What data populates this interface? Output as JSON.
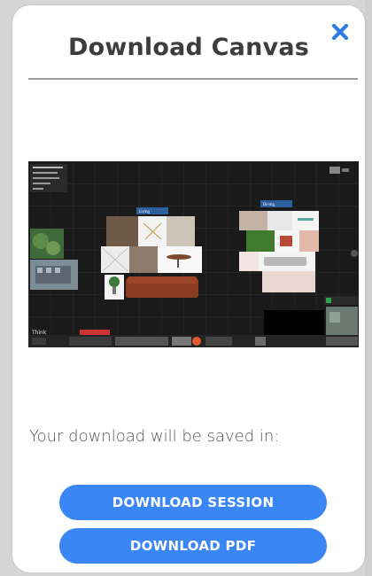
{
  "dialog": {
    "title": "Download Canvas",
    "close_icon": "close-icon",
    "saved_text": "Your download will be saved in:",
    "download_session_label": "DOWNLOAD SESSION",
    "download_pdf_label": "DOWNLOAD PDF"
  },
  "preview": {
    "brand": "Think",
    "board_left_label": "Living",
    "board_right_label": "Dining"
  },
  "colors": {
    "accent": "#3b86f5",
    "close": "#2f7de0",
    "canvas_bg": "#1c1c1c"
  }
}
